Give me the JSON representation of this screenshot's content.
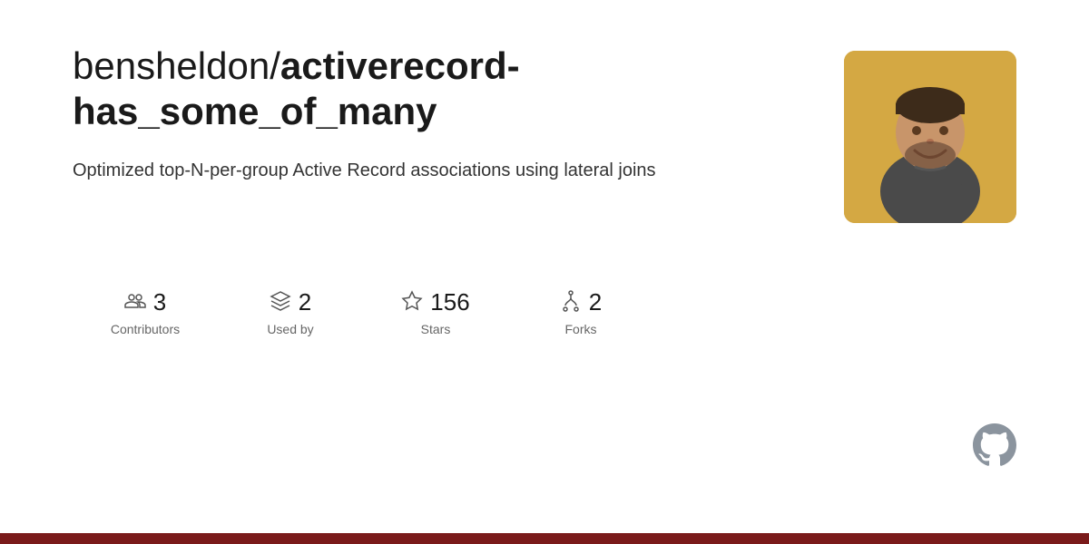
{
  "repo": {
    "owner": "bensheldon",
    "name": "activerecord-has_some_of_many",
    "description": "Optimized top-N-per-group Active Record associations using lateral joins"
  },
  "stats": [
    {
      "id": "contributors",
      "number": "3",
      "label": "Contributors"
    },
    {
      "id": "used-by",
      "number": "2",
      "label": "Used by"
    },
    {
      "id": "stars",
      "number": "156",
      "label": "Stars"
    },
    {
      "id": "forks",
      "number": "2",
      "label": "Forks"
    }
  ],
  "colors": {
    "bottom_bar": "#7a1a1a",
    "github_icon": "#8b949e"
  }
}
